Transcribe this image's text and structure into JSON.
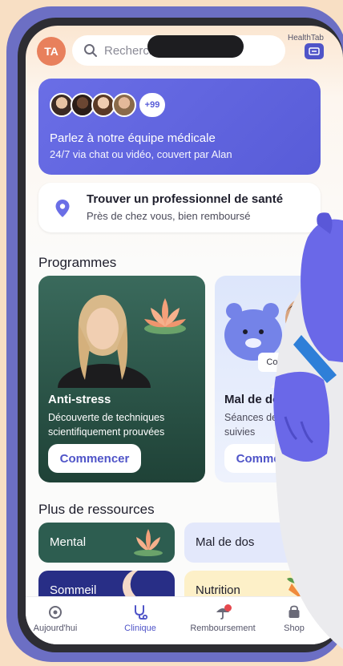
{
  "header": {
    "avatar_initials": "TA",
    "search_placeholder": "Rechercher",
    "brand_label": "HealthTab"
  },
  "team_card": {
    "more_count": "+99",
    "title": "Parlez à notre équipe médicale",
    "subtitle": "24/7 via chat ou vidéo, couvert par Alan"
  },
  "find_card": {
    "title": "Trouver un professionnel de santé",
    "subtitle": "Près de chez vous, bien remboursé"
  },
  "programmes": {
    "section_title": "Programmes",
    "cards": [
      {
        "title": "Anti-stress",
        "description": "Découverte de techniques scientifiquement prouvées",
        "button": "Commencer"
      },
      {
        "title": "Mal de dos",
        "description": "Séances de quelques jours, suivies",
        "button": "Commencer",
        "chip": "Consultation"
      }
    ]
  },
  "resources": {
    "section_title": "Plus de ressources",
    "tiles": [
      {
        "label": "Mental"
      },
      {
        "label": "Mal de dos"
      },
      {
        "label": "Sommeil"
      },
      {
        "label": "Nutrition"
      }
    ]
  },
  "tabbar": {
    "tabs": [
      {
        "label": "Aujourd'hui"
      },
      {
        "label": "Clinique"
      },
      {
        "label": "Remboursement"
      },
      {
        "label": "Shop"
      }
    ]
  },
  "colors": {
    "accent": "#4f54c8",
    "team_card": "#6a6ee6",
    "programme_dark": "#2c5a4c",
    "background": "#f8dfc4",
    "mascot": "#6a68e8"
  }
}
